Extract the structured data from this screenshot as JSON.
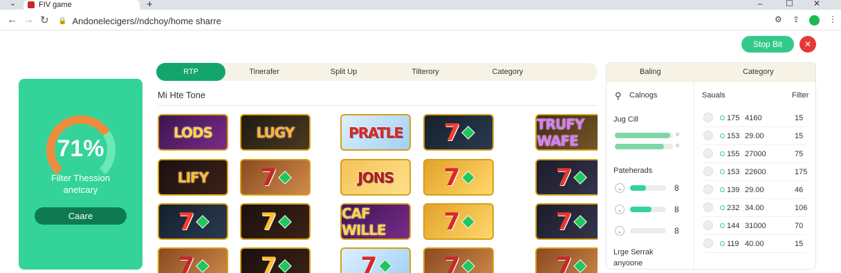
{
  "browser": {
    "tab_title": "FIV game",
    "url": "Andonelecigers//ndchoy/home sharre",
    "new_tab_glyph": "+",
    "tab_menu_glyph": "⌄",
    "back_glyph": "←",
    "forward_glyph": "→",
    "reload_glyph": "↻",
    "lock_glyph": "🔒",
    "min_glyph": "–",
    "max_glyph": "☐",
    "close_glyph": "✕",
    "ext_icons": [
      "puzzle-icon",
      "share-icon",
      "menu-dots-icon"
    ]
  },
  "header": {
    "stop_label": "Stop Bit",
    "close_glyph": "✕",
    "accent": "#34c98a",
    "danger": "#e53935"
  },
  "left_card": {
    "percent": "71%",
    "progress": 0.71,
    "line1": "Filter Thession",
    "line2": "anetcary",
    "button_label": "Caare",
    "color": "#34d399"
  },
  "tabs": [
    {
      "label": "RTP",
      "active": true
    },
    {
      "label": "Tinerafer",
      "active": false
    },
    {
      "label": "Split Up",
      "active": false
    },
    {
      "label": "Tilterory",
      "active": false
    },
    {
      "label": "Category",
      "active": false
    }
  ],
  "main": {
    "section_title": "Mi Hte Tone"
  },
  "games": [
    {
      "label": "LODS",
      "theme": "purple"
    },
    {
      "label": "LUGY",
      "theme": "dark"
    },
    {
      "label": "PRATLE",
      "theme": "sky"
    },
    {
      "label": "",
      "theme": "gems"
    },
    {
      "label": "TRUFY WAFE",
      "theme": "jungle"
    },
    {
      "label": "LIFY",
      "theme": "darkfire"
    },
    {
      "label": "",
      "theme": "copper"
    },
    {
      "label": "JONS",
      "theme": "gold"
    },
    {
      "label": "",
      "theme": "goldgreen"
    },
    {
      "label": "",
      "theme": "darkgems"
    },
    {
      "label": "",
      "theme": "gems"
    },
    {
      "label": "",
      "theme": "darkfire"
    },
    {
      "label": "CAF WILLE",
      "theme": "purple"
    },
    {
      "label": "",
      "theme": "goldgreen"
    },
    {
      "label": "",
      "theme": "darkgems"
    },
    {
      "label": "",
      "theme": "copper"
    },
    {
      "label": "",
      "theme": "darkfire"
    },
    {
      "label": "",
      "theme": "sky"
    },
    {
      "label": "",
      "theme": "copper"
    },
    {
      "label": "",
      "theme": "copper"
    }
  ],
  "right_panel": {
    "head_left": "Baling",
    "head_right": "Category",
    "search_label": "Calnogs",
    "section1_title": "Jug Cill",
    "bars1": [
      {
        "value": 0.95,
        "end_glyph": "○"
      },
      {
        "value": 0.85,
        "end_glyph": "○"
      }
    ],
    "section2_title": "Pateherads",
    "bars2": [
      {
        "value": 0.45,
        "count": "8"
      },
      {
        "value": 0.6,
        "count": "8"
      },
      {
        "value": 0.0,
        "count": "8"
      }
    ],
    "section3_line1": "Lrge Serrak",
    "section3_line2": "anyoone",
    "col1_label": "Sauals",
    "col2_label": "Filter",
    "rows": [
      {
        "a": "175",
        "b": "4160",
        "c": "15"
      },
      {
        "a": "153",
        "b": "29.00",
        "c": "15"
      },
      {
        "a": "155",
        "b": "27000",
        "c": "75"
      },
      {
        "a": "153",
        "b": "22600",
        "c": "175"
      },
      {
        "a": "139",
        "b": "29.00",
        "c": "46"
      },
      {
        "a": "232",
        "b": "34.00",
        "c": "106"
      },
      {
        "a": "144",
        "b": "31000",
        "c": "70"
      },
      {
        "a": "119",
        "b": "40.00",
        "c": "15"
      }
    ]
  }
}
